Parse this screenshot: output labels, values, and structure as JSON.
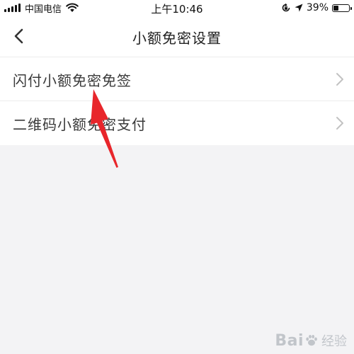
{
  "status_bar": {
    "carrier": "中国电信",
    "time": "上午10:46",
    "battery_percent": "39%",
    "battery_level": 0.39
  },
  "nav": {
    "title": "小额免密设置",
    "back_icon": "chevron-left-icon"
  },
  "settings": {
    "items": [
      {
        "label": "闪付小额免密免签",
        "icon": "chevron-right-icon"
      },
      {
        "label": "二维码小额免密支付",
        "icon": "chevron-right-icon"
      }
    ]
  },
  "annotation": {
    "color": "#e8262b"
  },
  "watermark": {
    "brand_a": "Bai",
    "brand_b": "经验",
    "suffix": ""
  },
  "colors": {
    "page_bg": "#f3f3f5",
    "separator": "#ececec",
    "chevron": "#c2c2c2"
  }
}
